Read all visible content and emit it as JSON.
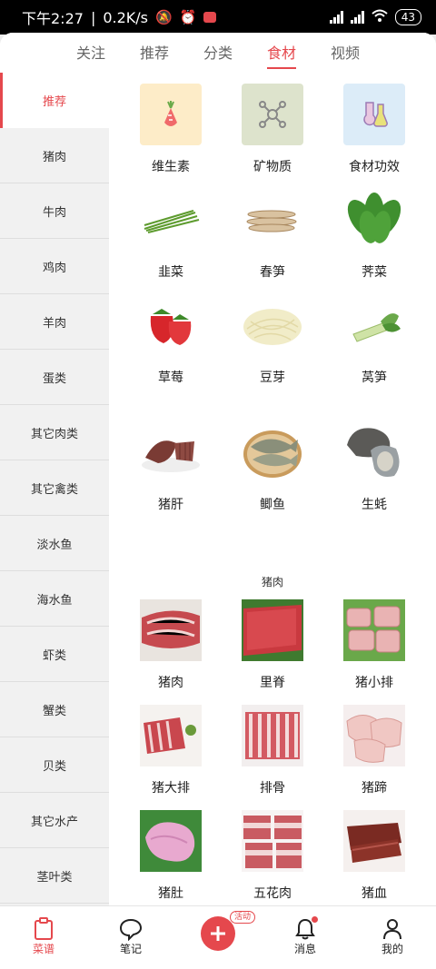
{
  "status": {
    "time": "下午2:27",
    "speed": "0.2K/s",
    "battery": "43"
  },
  "tabs": [
    {
      "label": "关注"
    },
    {
      "label": "推荐"
    },
    {
      "label": "分类"
    },
    {
      "label": "食材"
    },
    {
      "label": "视频"
    }
  ],
  "active_tab": "食材",
  "sidebar": [
    {
      "label": "推荐"
    },
    {
      "label": "猪肉"
    },
    {
      "label": "牛肉"
    },
    {
      "label": "鸡肉"
    },
    {
      "label": "羊肉"
    },
    {
      "label": "蛋类"
    },
    {
      "label": "其它肉类"
    },
    {
      "label": "其它禽类"
    },
    {
      "label": "淡水鱼"
    },
    {
      "label": "海水鱼"
    },
    {
      "label": "虾类"
    },
    {
      "label": "蟹类"
    },
    {
      "label": "贝类"
    },
    {
      "label": "其它水产"
    },
    {
      "label": "茎叶类"
    }
  ],
  "recommend": [
    {
      "label": "维生素",
      "icon": "carrot-icon",
      "bg": "#fdecc8"
    },
    {
      "label": "矿物质",
      "icon": "molecule-icon",
      "bg": "#dde3cc"
    },
    {
      "label": "食材功效",
      "icon": "flask-icon",
      "bg": "#dcecf8"
    },
    {
      "label": "韭菜",
      "icon": "chives-photo"
    },
    {
      "label": "春笋",
      "icon": "bamboo-shoot-photo"
    },
    {
      "label": "荠菜",
      "icon": "shepherds-purse-photo"
    },
    {
      "label": "草莓",
      "icon": "strawberry-photo"
    },
    {
      "label": "豆芽",
      "icon": "bean-sprouts-photo"
    },
    {
      "label": "莴笋",
      "icon": "celtuce-photo"
    },
    {
      "label": "猪肝",
      "icon": "pork-liver-photo"
    },
    {
      "label": "鲫鱼",
      "icon": "crucian-carp-photo"
    },
    {
      "label": "生蚝",
      "icon": "oyster-photo"
    }
  ],
  "pork_section": {
    "title": "猪肉",
    "items": [
      {
        "label": "猪肉",
        "icon": "pork-photo"
      },
      {
        "label": "里脊",
        "icon": "tenderloin-photo"
      },
      {
        "label": "猪小排",
        "icon": "spare-ribs-photo"
      },
      {
        "label": "猪大排",
        "icon": "pork-chop-photo"
      },
      {
        "label": "排骨",
        "icon": "ribs-photo"
      },
      {
        "label": "猪蹄",
        "icon": "trotters-photo"
      },
      {
        "label": "猪肚",
        "icon": "pork-belly-tripe-photo"
      },
      {
        "label": "五花肉",
        "icon": "pork-belly-photo"
      },
      {
        "label": "猪血",
        "icon": "pork-blood-photo"
      }
    ]
  },
  "bottom_nav": [
    {
      "label": "菜谱"
    },
    {
      "label": "笔记"
    },
    {
      "label": ""
    },
    {
      "label": "消息"
    },
    {
      "label": "我的"
    }
  ],
  "promo_badge": "活动",
  "colors": {
    "accent": "#e5484d"
  }
}
